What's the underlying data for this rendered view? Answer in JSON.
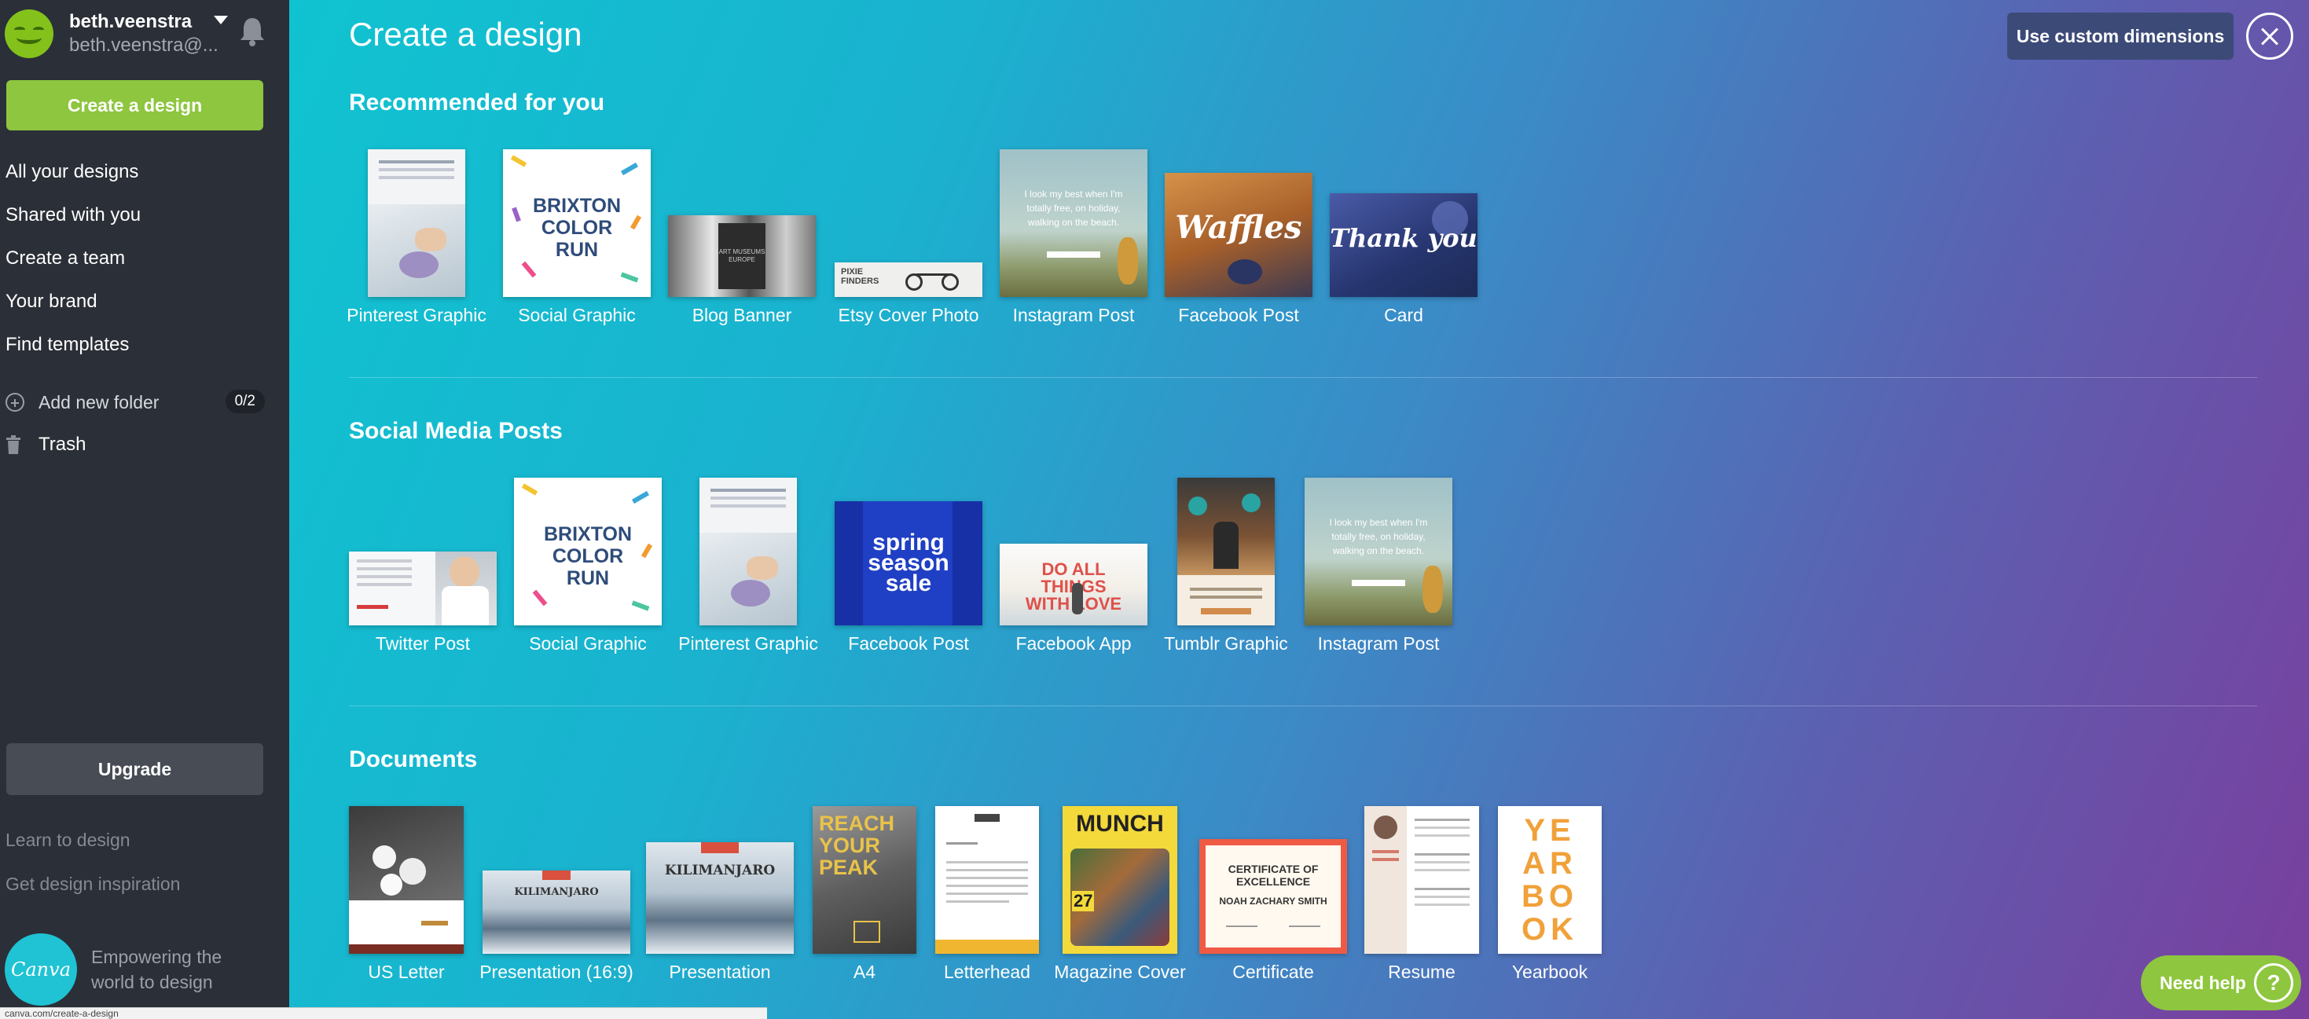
{
  "user": {
    "name": "beth.veenstra",
    "email": "beth.veenstra@..."
  },
  "sidebar": {
    "create_label": "Create a design",
    "nav": [
      "All your designs",
      "Shared with you",
      "Create a team",
      "Your brand",
      "Find templates"
    ],
    "add_folder_label": "Add new folder",
    "folder_count": "0/2",
    "trash_label": "Trash",
    "upgrade_label": "Upgrade",
    "learn_label": "Learn to design",
    "inspiration_label": "Get design inspiration",
    "logo_text": "Canva",
    "tagline": "Empowering the world to design"
  },
  "main": {
    "title": "Create a design",
    "custom_button": "Use custom dimensions",
    "sections": [
      {
        "title": "Recommended for you",
        "items": [
          "Pinterest Graphic",
          "Social Graphic",
          "Blog Banner",
          "Etsy Cover Photo",
          "Instagram Post",
          "Facebook Post",
          "Card"
        ]
      },
      {
        "title": "Social Media Posts",
        "items": [
          "Twitter Post",
          "Social Graphic",
          "Pinterest Graphic",
          "Facebook Post",
          "Facebook App",
          "Tumblr Graphic",
          "Instagram Post"
        ]
      },
      {
        "title": "Documents",
        "items": [
          "US Letter",
          "Presentation (16:9)",
          "Presentation",
          "A4",
          "Letterhead",
          "Magazine Cover",
          "Certificate",
          "Resume",
          "Yearbook"
        ]
      }
    ]
  },
  "thumb_text": {
    "brixton": "BRIXTON COLOR RUN",
    "spring": "spring season sale",
    "waffles": "Waffles",
    "thankyou": "Thank you",
    "quote": "I look my best when I'm totally free, on holiday, walking on the beach.",
    "munch": "MUNCH",
    "munch_num": "27",
    "cert_title": "CERTIFICATE OF EXCELLENCE",
    "cert_name": "NOAH ZACHARY SMITH",
    "yearbook": "YEARBOOK",
    "reach": "REACH YOUR PEAK",
    "kili": "KILIMANJARO",
    "fb_app": "DO ALL THINGS WITH LOVE",
    "etsy": "PIXIE FINDERS",
    "museums": "ART MUSEUMS EUROPE"
  },
  "help": {
    "label": "Need help",
    "icon": "?"
  },
  "status": {
    "url": "canva.com/create-a-design"
  },
  "colors": {
    "accent": "#8ec63f",
    "sidebar": "#2b2f37",
    "custom_button": "#3c4a78"
  }
}
